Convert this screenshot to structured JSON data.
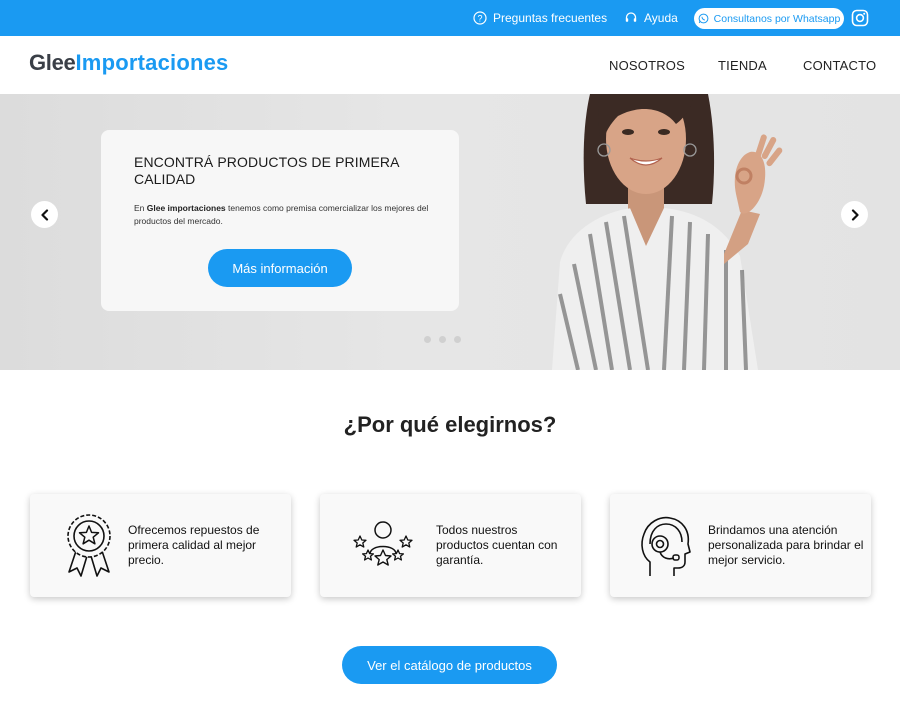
{
  "topbar": {
    "faq_label": "Preguntas frecuentes",
    "help_label": "Ayuda",
    "whatsapp_label": "Consultanos por Whatsapp"
  },
  "header": {
    "logo_part1": "Glee",
    "logo_part2": "Importaciones",
    "nav": [
      "NOSOTROS",
      "TIENDA",
      "CONTACTO"
    ]
  },
  "hero": {
    "title": "ENCONTRÁ PRODUCTOS DE PRIMERA CALIDAD",
    "text_brand": "Glee importaciones",
    "text_prefix": "En ",
    "text_rest": " tenemos como premisa comercializar los mejores del productos del mercado.",
    "button_label": "Más información",
    "slide_count": 3,
    "active_slide": 1
  },
  "why": {
    "title": "¿Por qué elegirnos?",
    "features": [
      {
        "icon": "award-badge-icon",
        "text": "Ofrecemos repuestos de primera calidad al mejor precio."
      },
      {
        "icon": "stars-user-icon",
        "text": "Todos nuestros productos cuentan con garantía."
      },
      {
        "icon": "headset-support-icon",
        "text": "Brindamos una atención personalizada para brindar el mejor servicio."
      }
    ]
  },
  "cta_label": "Ver el catálogo de productos",
  "colors": {
    "accent": "#1a9af2",
    "text": "#222222",
    "logo_dark": "#3a3f47"
  }
}
